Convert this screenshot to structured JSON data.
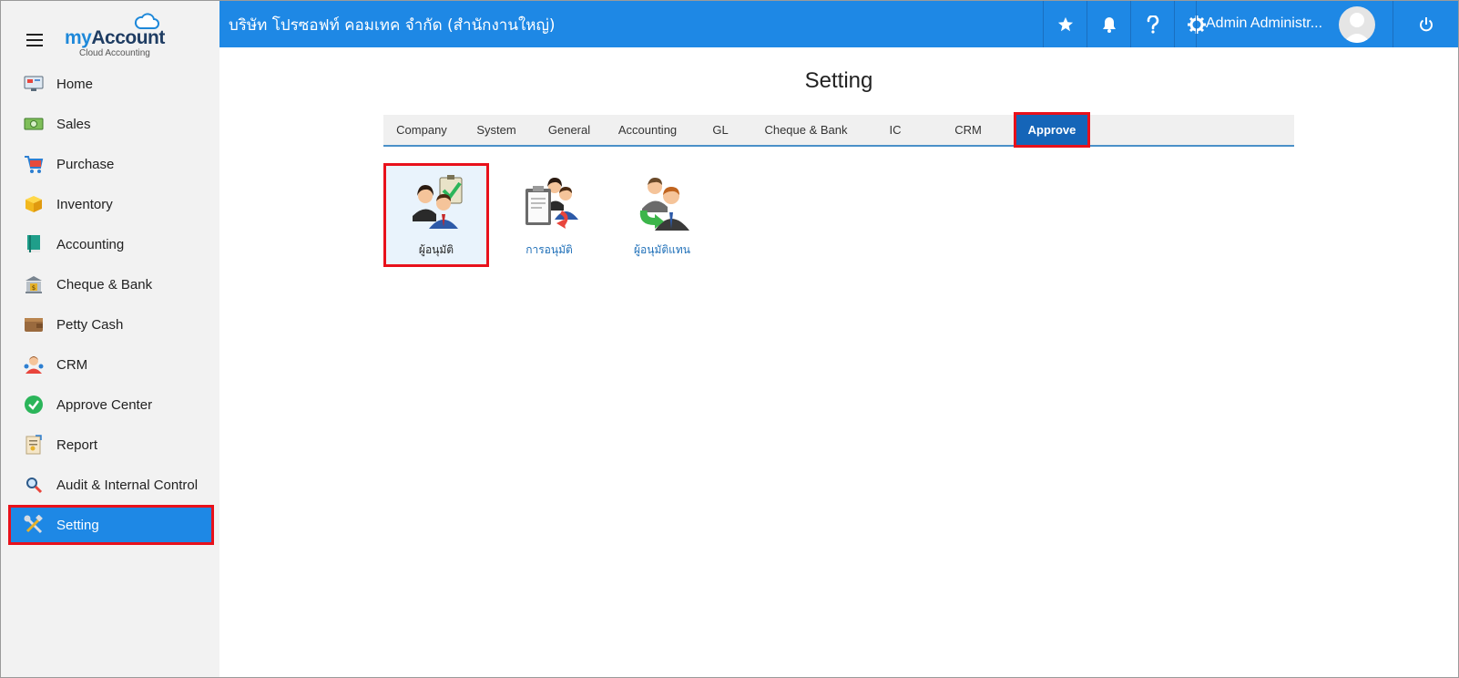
{
  "brand": {
    "name_my": "my",
    "name_account": "Account",
    "subtitle": "Cloud Accounting"
  },
  "sidebar": {
    "items": [
      {
        "label": "Home",
        "icon": "monitor-icon"
      },
      {
        "label": "Sales",
        "icon": "cash-icon"
      },
      {
        "label": "Purchase",
        "icon": "cart-icon"
      },
      {
        "label": "Inventory",
        "icon": "box-icon"
      },
      {
        "label": "Accounting",
        "icon": "book-icon"
      },
      {
        "label": "Cheque & Bank",
        "icon": "bank-icon"
      },
      {
        "label": "Petty Cash",
        "icon": "wallet-icon"
      },
      {
        "label": "CRM",
        "icon": "people-icon"
      },
      {
        "label": "Approve Center",
        "icon": "check-circle-icon"
      },
      {
        "label": "Report",
        "icon": "report-icon"
      },
      {
        "label": "Audit & Internal Control",
        "icon": "magnifier-icon"
      },
      {
        "label": "Setting",
        "icon": "tools-icon",
        "active": true
      }
    ]
  },
  "header": {
    "company": "บริษัท โปรซอฟท์ คอมเทค จำกัด (สำนักงานใหญ่)",
    "user_name": "Admin Administr...",
    "accent_color": "#1e88e5"
  },
  "main": {
    "title": "Setting",
    "tabs": [
      {
        "label": "Company"
      },
      {
        "label": "System"
      },
      {
        "label": "General"
      },
      {
        "label": "Accounting"
      },
      {
        "label": "GL"
      },
      {
        "label": "Cheque & Bank"
      },
      {
        "label": "IC"
      },
      {
        "label": "CRM"
      },
      {
        "label": "Approve",
        "active": true
      }
    ],
    "tiles": [
      {
        "label": "ผู้อนุมัติ",
        "icon": "approver-icon",
        "active": true
      },
      {
        "label": "การอนุมัติ",
        "icon": "approval-document-icon"
      },
      {
        "label": "ผู้อนุมัติแทน",
        "icon": "substitute-approver-icon"
      }
    ]
  }
}
